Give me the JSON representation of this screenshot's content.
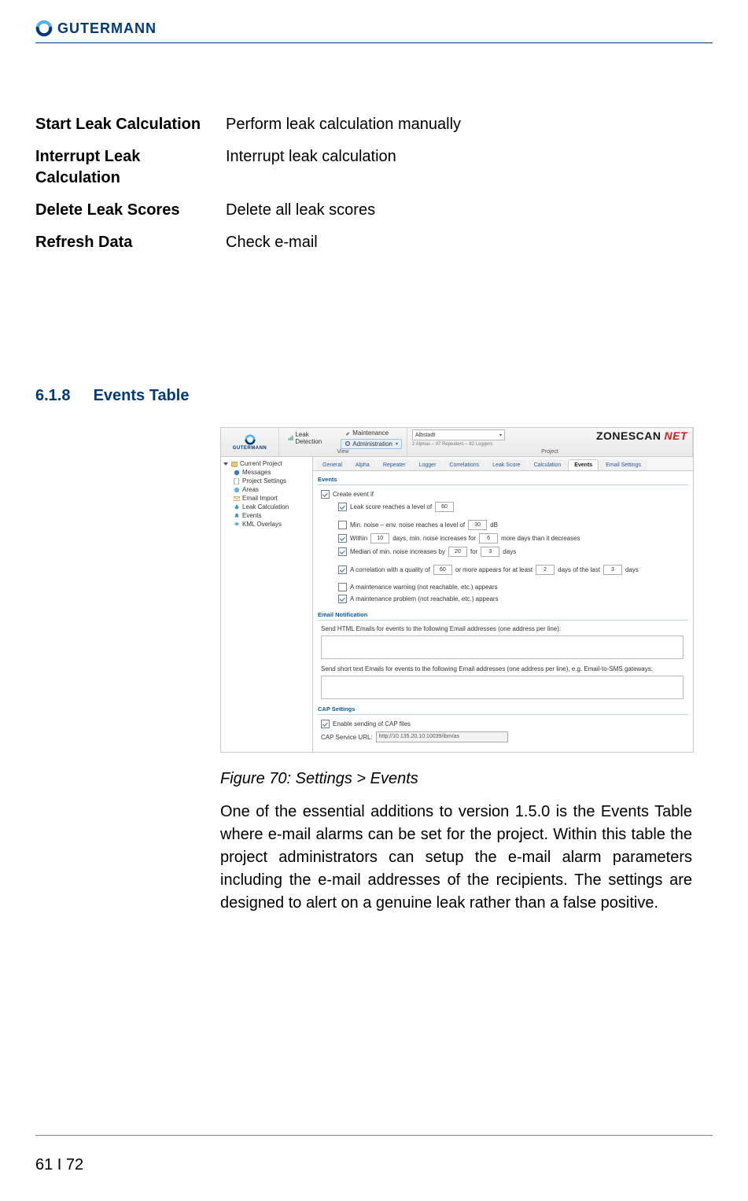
{
  "brand": "GUTERMANN",
  "defs": [
    {
      "label": "Start Leak Calculation",
      "value": "Perform leak calculation manually"
    },
    {
      "label": "Interrupt Leak Calculation",
      "value": "Interrupt leak calculation"
    },
    {
      "label": "Delete Leak Scores",
      "value": "Delete all leak scores"
    },
    {
      "label": "Refresh Data",
      "value": "Check e-mail"
    }
  ],
  "section": {
    "number": "6.1.8",
    "title": "Events Table"
  },
  "figure_caption": "Figure 70: Settings > Events",
  "body": "One of the essential additions to version 1.5.0 is the Events Table where e-mail alarms can be set for the project. Within this table the project administrators can setup the e-mail alarm parameters including the e-mail addresses of the recipients. The settings are designed to alert on a genuine leak rather than a false positive.",
  "page_number": "61 I 72",
  "app": {
    "logo": "GUTERMANN",
    "zonescan": "ZONESCAN",
    "zonescan_net": "NET",
    "ribbon": {
      "view_title": "View",
      "project_title": "Project",
      "leak_detection": "Leak Detection",
      "maintenance": "Maintenance",
      "administration": "Administration",
      "combo_value": "Albstadt",
      "combo_sub": "2 Alphas – 07 Repeaters – 82 Loggers"
    },
    "tree": {
      "root": "Current Project",
      "items": [
        "Messages",
        "Project Settings",
        "Areas",
        "Email Import",
        "Leak Calculation",
        "Events",
        "KML Overlays"
      ]
    },
    "tabs": [
      "General",
      "Alpha",
      "Repeater",
      "Logger",
      "Correlations",
      "Leak Score",
      "Calculation",
      "Events",
      "Email Settings"
    ],
    "active_tab": "Events",
    "events_group": "Events",
    "create_if": "Create event if",
    "rule1_a": "Leak score reaches a level of",
    "rule1_v": "60",
    "rule2_a": "Min. noise – env. noise reaches a level of",
    "rule2_v": "30",
    "rule2_b": "dB",
    "rule3_a": "Within",
    "rule3_v1": "10",
    "rule3_b": "days, min. noise increases for",
    "rule3_v2": "6",
    "rule3_c": "more days than it decreases",
    "rule4_a": "Median of min. noise increases by",
    "rule4_v1": "20",
    "rule4_b": "for",
    "rule4_v2": "3",
    "rule4_c": "days",
    "rule5_a": "A correlation with a quality of",
    "rule5_v1": "60",
    "rule5_b": "or more appears for at least",
    "rule5_v2": "2",
    "rule5_c": "days of the last",
    "rule5_v3": "3",
    "rule5_d": "days",
    "rule6": "A maintenance warning (not reachable, etc.) appears",
    "rule7": "A maintenance problem (not reachable, etc.) appears",
    "email_group": "Email Notification",
    "email_html": "Send HTML Emails for events to the following Email addresses (one address per line):",
    "email_sms": "Send short text Emails for events to the following Email addresses (one address per line), e.g. Email-to-SMS gateways:",
    "cap_group": "CAP Settings",
    "cap_enable": "Enable sending of CAP files",
    "cap_url_label": "CAP Service URL:",
    "cap_url": "http://10.135.20.10:10039/ibm/as"
  }
}
